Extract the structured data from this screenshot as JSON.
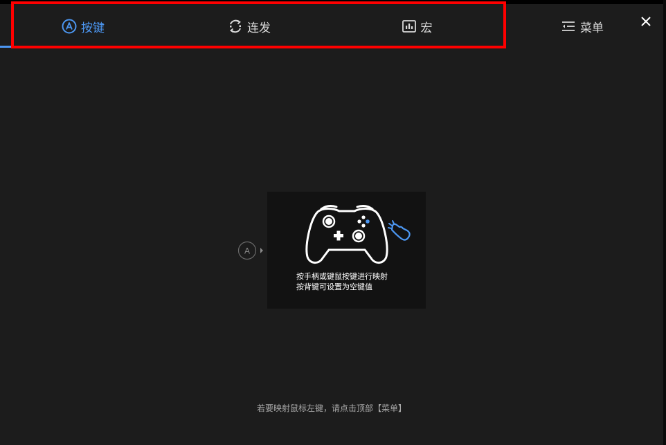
{
  "tabs": [
    {
      "label": "按键",
      "icon": "a-circle-icon",
      "active": true
    },
    {
      "label": "连发",
      "icon": "turbo-icon",
      "active": false
    },
    {
      "label": "宏",
      "icon": "macro-icon",
      "active": false
    }
  ],
  "menu": {
    "label": "菜单",
    "icon": "menu-lines-icon"
  },
  "close": {
    "icon": "close-icon"
  },
  "mapping": {
    "key_marker": "A",
    "instruction_line1": "按手柄或键鼠按键进行映射",
    "instruction_line2": "按背键可设置为空键值"
  },
  "footer": {
    "hint": "若要映射鼠标左键，请点击顶部【菜单】"
  },
  "colors": {
    "accent": "#4c97f2",
    "background": "#1c1c1c",
    "card": "#121212",
    "highlight": "#ff0000"
  }
}
